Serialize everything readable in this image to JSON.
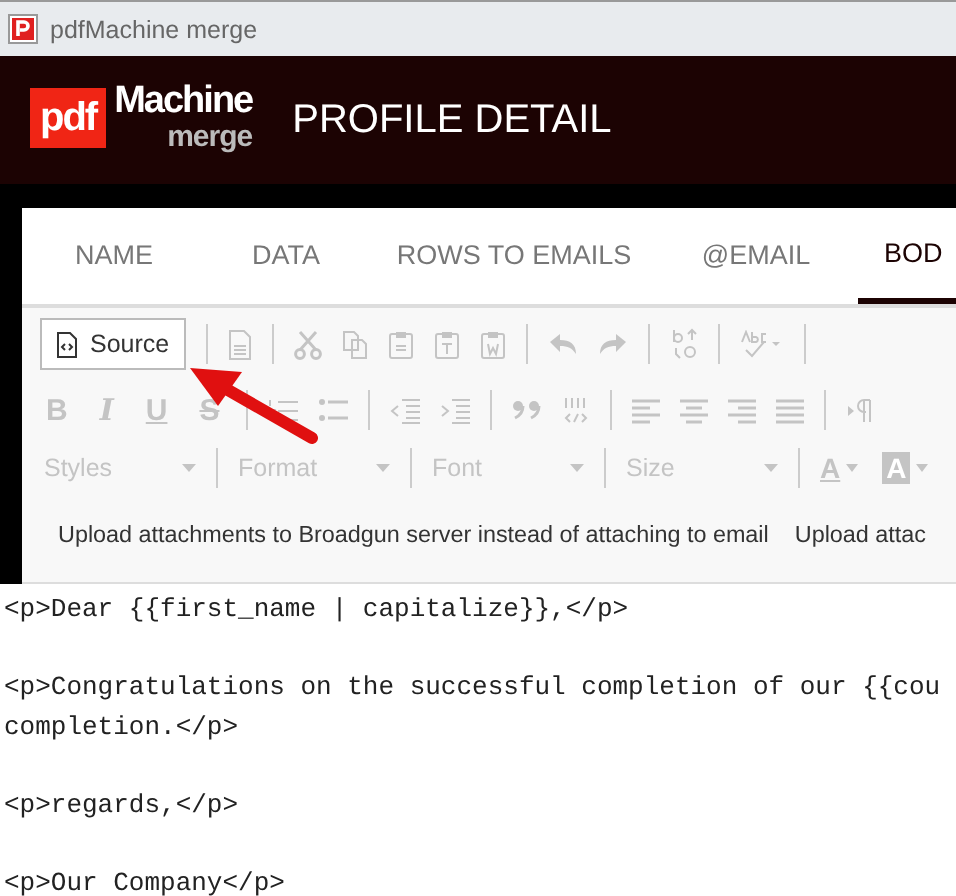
{
  "window": {
    "title": "pdfMachine merge"
  },
  "header": {
    "logo": {
      "pdf": "pdf",
      "machine": "Machine",
      "merge": "merge"
    },
    "title": "PROFILE DETAIL"
  },
  "tabs": [
    {
      "label": "NAME",
      "selected": false
    },
    {
      "label": "DATA",
      "selected": false
    },
    {
      "label": "ROWS TO EMAILS",
      "selected": false
    },
    {
      "label": "@EMAIL",
      "selected": false
    },
    {
      "label": "BOD",
      "selected": true
    }
  ],
  "toolbar": {
    "source_button": "Source",
    "format_buttons": [
      "B",
      "I",
      "U",
      "S"
    ],
    "dropdowns": [
      "Styles",
      "Format",
      "Font",
      "Size"
    ],
    "color_buttons": [
      "A",
      "A"
    ],
    "attachments": [
      "Upload attachments to Broadgun server instead of attaching to email",
      "Upload attac"
    ]
  },
  "editor": {
    "paragraphs": [
      [
        "<p>Dear {{first_name | capitalize}},</p>"
      ],
      [
        "<p>Congratulations on the successful completion of our {{cou",
        "completion.</p>"
      ],
      [
        "<p>regards,</p>"
      ],
      [
        "<p>Our Company</p>"
      ]
    ]
  }
}
